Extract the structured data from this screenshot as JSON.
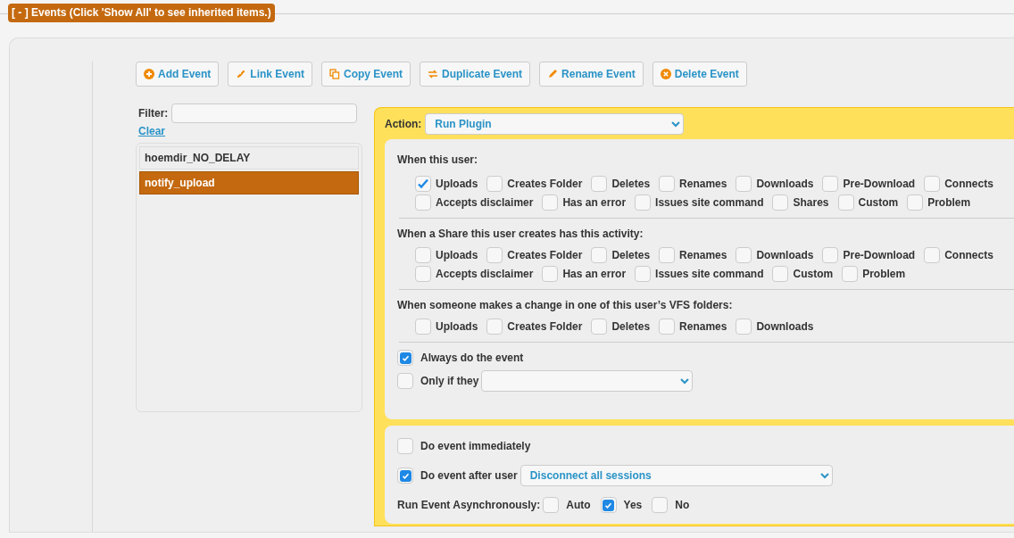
{
  "section_header": "[ - ] Events (Click 'Show All' to see inherited items.)",
  "toolbar": [
    "Add Event",
    "Link Event",
    "Copy Event",
    "Duplicate Event",
    "Rename Event",
    "Delete Event"
  ],
  "filter": {
    "label": "Filter:",
    "clear": "Clear"
  },
  "events": [
    {
      "name": "hoemdir_NO_DELAY",
      "selected": false
    },
    {
      "name": "notify_upload",
      "selected": true
    }
  ],
  "action": {
    "label": "Action:",
    "value": "Run Plugin"
  },
  "triggers": [
    {
      "title": "When this user:",
      "options": [
        {
          "label": "Uploads",
          "checked": true
        },
        {
          "label": "Creates Folder",
          "checked": false
        },
        {
          "label": "Deletes",
          "checked": false
        },
        {
          "label": "Renames",
          "checked": false
        },
        {
          "label": "Downloads",
          "checked": false
        },
        {
          "label": "Pre-Download",
          "checked": false
        },
        {
          "label": "Connects",
          "checked": false
        },
        {
          "label": "Accepts disclaimer",
          "checked": false
        },
        {
          "label": "Has an error",
          "checked": false
        },
        {
          "label": "Issues site command",
          "checked": false
        },
        {
          "label": "Shares",
          "checked": false
        },
        {
          "label": "Custom",
          "checked": false
        },
        {
          "label": "Problem",
          "checked": false
        }
      ]
    },
    {
      "title": "When a Share this user creates has this activity:",
      "options": [
        {
          "label": "Uploads",
          "checked": false
        },
        {
          "label": "Creates Folder",
          "checked": false
        },
        {
          "label": "Deletes",
          "checked": false
        },
        {
          "label": "Renames",
          "checked": false
        },
        {
          "label": "Downloads",
          "checked": false
        },
        {
          "label": "Pre-Download",
          "checked": false
        },
        {
          "label": "Connects",
          "checked": false
        },
        {
          "label": "Accepts disclaimer",
          "checked": false
        },
        {
          "label": "Has an error",
          "checked": false
        },
        {
          "label": "Issues site command",
          "checked": false
        },
        {
          "label": "Custom",
          "checked": false
        },
        {
          "label": "Problem",
          "checked": false
        }
      ]
    },
    {
      "title": "When someone makes a change in one of this user’s VFS folders:",
      "options": [
        {
          "label": "Uploads",
          "checked": false
        },
        {
          "label": "Creates Folder",
          "checked": false
        },
        {
          "label": "Deletes",
          "checked": false
        },
        {
          "label": "Renames",
          "checked": false
        },
        {
          "label": "Downloads",
          "checked": false
        }
      ]
    }
  ],
  "conditions": [
    {
      "kind": "plain",
      "label": "Always do the event",
      "checked": true
    },
    {
      "kind": "select",
      "label": "Only if they",
      "checked": false
    }
  ],
  "timing": [
    {
      "kind": "plain",
      "label": "Do event immediately",
      "checked": false
    },
    {
      "kind": "select",
      "label": "Do event after user",
      "checked": true,
      "value": "Disconnect all sessions"
    }
  ],
  "async": {
    "label": "Run Event Asynchronously:",
    "options": [
      {
        "label": "Auto",
        "selected": false
      },
      {
        "label": "Yes",
        "selected": true
      },
      {
        "label": "No",
        "selected": false
      }
    ]
  }
}
